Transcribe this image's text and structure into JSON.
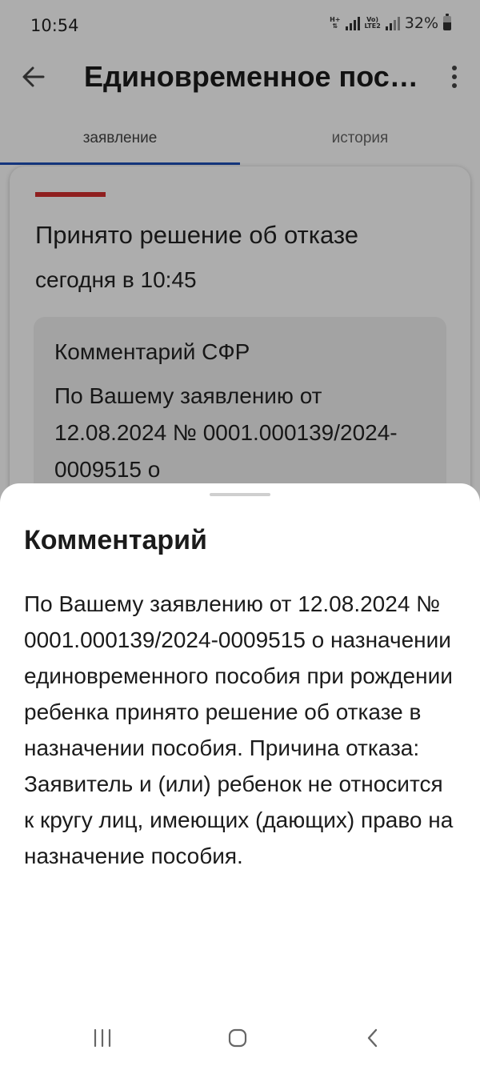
{
  "status_bar": {
    "time": "10:54",
    "net1": "H+",
    "net2_top": "Vo)",
    "net2_bottom": "LTE2",
    "battery": "32%"
  },
  "app_bar": {
    "title": "Единовременное пособие при рождении ребенка",
    "back_icon": "arrow-back-icon",
    "more_icon": "more-vert-icon"
  },
  "tabs": [
    {
      "label": "заявление",
      "active": true
    },
    {
      "label": "история",
      "active": false
    }
  ],
  "status_card": {
    "title": "Принято решение об отказе",
    "date": "сегодня в 10:45",
    "accent_color": "#d32f2f",
    "comment_label": "Комментарий СФР",
    "comment_preview": "По Вашему заявлению от 12.08.2024 № 0001.000139/2024-0009515 о"
  },
  "sheet": {
    "title": "Комментарий",
    "body": "По Вашему заявлению от 12.08.2024 № 0001.000139/2024-0009515 о назначении единовременного пособия при рождении ребенка принято решение об отказе в назначении пособия. Причина отказа: Заявитель и (или) ребенок не относится к кругу лиц, имеющих (дающих) право на назначение пособия."
  },
  "nav_bar": {
    "recents_icon": "recents-icon",
    "home_icon": "home-icon",
    "back_icon": "nav-back-icon"
  },
  "colors": {
    "tab_indicator": "#1e4fb8",
    "overlay": "rgba(0,0,0,0.32)"
  }
}
